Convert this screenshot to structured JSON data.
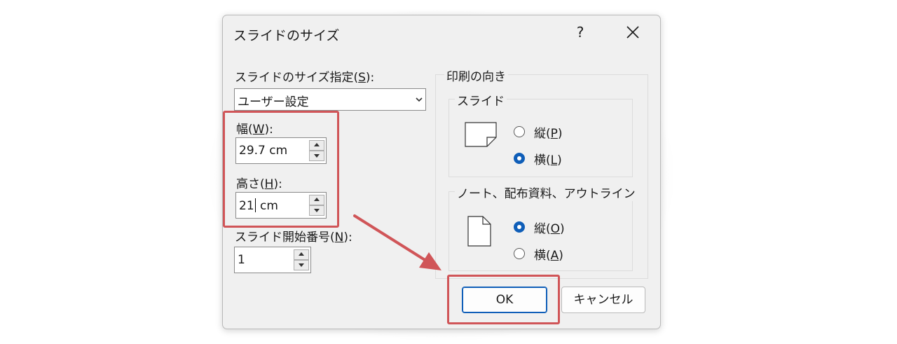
{
  "dialog": {
    "title": "スライドのサイズ",
    "help_label": "?",
    "slide_size": {
      "label_pre": "スライドのサイズ指定(",
      "label_key": "S",
      "label_post": "):",
      "value": "ユーザー設定"
    },
    "width": {
      "label_pre": "幅(",
      "label_key": "W",
      "label_post": "):",
      "value": "29.7 cm"
    },
    "height": {
      "label_pre": "高さ(",
      "label_key": "H",
      "label_post": "):",
      "value_before_caret": "21",
      "value_after_caret": " cm"
    },
    "start_number": {
      "label_pre": "スライド開始番号(",
      "label_key": "N",
      "label_post": "):",
      "value": "1"
    },
    "orientation": {
      "group_label": "印刷の向き",
      "slides": {
        "label": "スライド",
        "options": [
          {
            "pre": "縦(",
            "key": "P",
            "post": ")",
            "selected": false
          },
          {
            "pre": "横(",
            "key": "L",
            "post": ")",
            "selected": true
          }
        ]
      },
      "notes": {
        "label": "ノート、配布資料、アウトライン",
        "options": [
          {
            "pre": "縦(",
            "key": "O",
            "post": ")",
            "selected": true
          },
          {
            "pre": "横(",
            "key": "A",
            "post": ")",
            "selected": false
          }
        ]
      }
    },
    "ok_label": "OK",
    "cancel_label": "キャンセル"
  },
  "colors": {
    "accent": "#0f5eb8",
    "annotation": "#d05558",
    "dialog_bg": "#f0f0f0"
  }
}
